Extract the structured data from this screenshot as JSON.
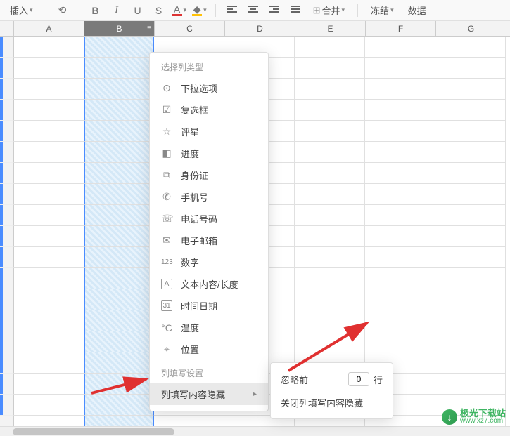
{
  "toolbar": {
    "insert_label": "插入",
    "merge_label": "合并",
    "freeze_label": "冻结",
    "data_label": "数据"
  },
  "columns": [
    "A",
    "B",
    "C",
    "D",
    "E",
    "F",
    "G"
  ],
  "selected_column": "B",
  "menu": {
    "section_title": "选择列类型",
    "items": [
      {
        "icon": "dropdown",
        "label": "下拉选项"
      },
      {
        "icon": "checkbox",
        "label": "复选框"
      },
      {
        "icon": "star",
        "label": "评星"
      },
      {
        "icon": "progress",
        "label": "进度"
      },
      {
        "icon": "id",
        "label": "身份证"
      },
      {
        "icon": "phone",
        "label": "手机号"
      },
      {
        "icon": "tel",
        "label": "电话号码"
      },
      {
        "icon": "email",
        "label": "电子邮箱"
      },
      {
        "icon": "number",
        "label": "数字"
      },
      {
        "icon": "text",
        "label": "文本内容/长度"
      },
      {
        "icon": "date",
        "label": "时间日期"
      },
      {
        "icon": "temp",
        "label": "温度"
      },
      {
        "icon": "location",
        "label": "位置"
      }
    ],
    "settings_title": "列填写设置",
    "hide_content_label": "列填写内容隐藏"
  },
  "submenu": {
    "ignore_prefix": "忽略前",
    "ignore_value": "0",
    "ignore_suffix": "行",
    "close_label": "关闭列填写内容隐藏"
  },
  "watermark": {
    "main": "极光下载站",
    "url": "www.xz7.com"
  }
}
